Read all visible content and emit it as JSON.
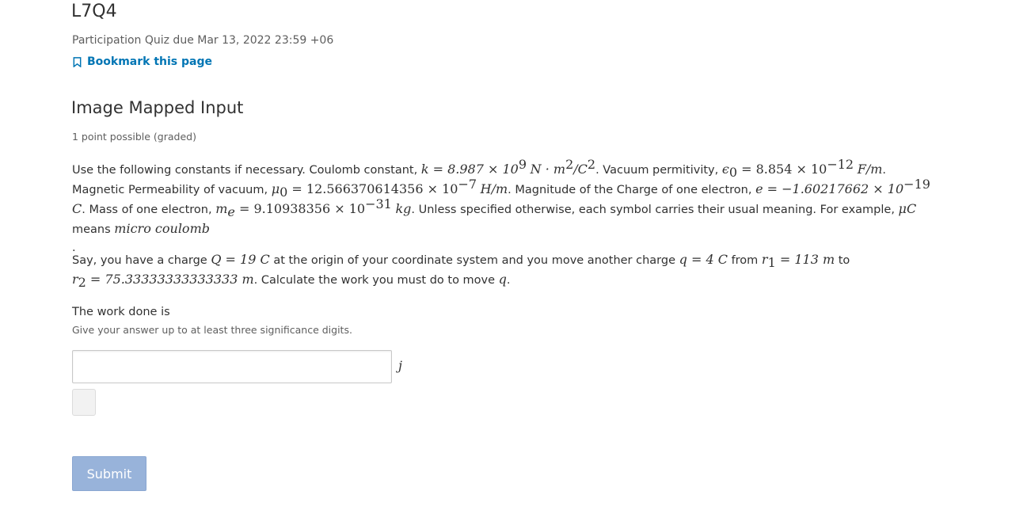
{
  "header": {
    "title": "L7Q4",
    "due": "Participation Quiz due Mar 13, 2022 23:59 +06",
    "bookmark_label": "Bookmark this page"
  },
  "problem": {
    "title": "Image Mapped Input",
    "points": "1 point possible (graded)",
    "constants": {
      "intro": "Use the following constants if necessary. Coulomb constant,",
      "k_expr": "k = 8.987 × 10",
      "k_exp": "9",
      "k_unit": "N · m",
      "k_unit_sq": "2",
      "k_unit_c": "/C",
      "k_unit_c_sq": "2",
      "eps_label": ". Vacuum permitivity,",
      "eps_sym": "ϵ",
      "eps_sub": "0",
      "eps_val": " = 8.854 × 10",
      "eps_exp": "−12",
      "eps_unit": "F/m",
      "mu_label": ". Magnetic Permeability of vacuum,",
      "mu_sym": "μ",
      "mu_sub": "0",
      "mu_val": " = 12.566370614356 × 10",
      "mu_exp": "−7",
      "mu_unit": "H/m",
      "e_label": ". Magnitude of the Charge of one electron,",
      "e_val": "e = −1.60217662 × 10",
      "e_exp": "−19",
      "e_unit": "C",
      "me_label": ". Mass of one electron,",
      "me_sym": "m",
      "me_sub": "e",
      "me_val": " = 9.10938356 × 10",
      "me_exp": "−31",
      "me_unit": "kg",
      "tail": ". Unless specified otherwise, each symbol carries their usual meaning. For example,",
      "uc": "μC",
      "means": "means",
      "micro": "micro coulomb",
      "dot": "."
    },
    "question": {
      "t1": "Say, you have a charge",
      "Q": "Q = 19 C",
      "t2": "at the origin of your coordinate system and you move another charge",
      "q": "q = 4 C",
      "t3": "from",
      "r1_sym": "r",
      "r1_sub": "1",
      "r1_val": " = 113 m",
      "t4": "to",
      "r2_sym": "r",
      "r2_sub": "2",
      "r2_val": " = 75.33333333333333 m",
      "t5": ". Calculate the work you must do to move",
      "qq": "q",
      "t6": "."
    },
    "answer_label": "The work done is",
    "answer_hint": "Give your answer up to at least three significance digits.",
    "answer_value": "",
    "unit": "j",
    "submit_label": "Submit"
  }
}
